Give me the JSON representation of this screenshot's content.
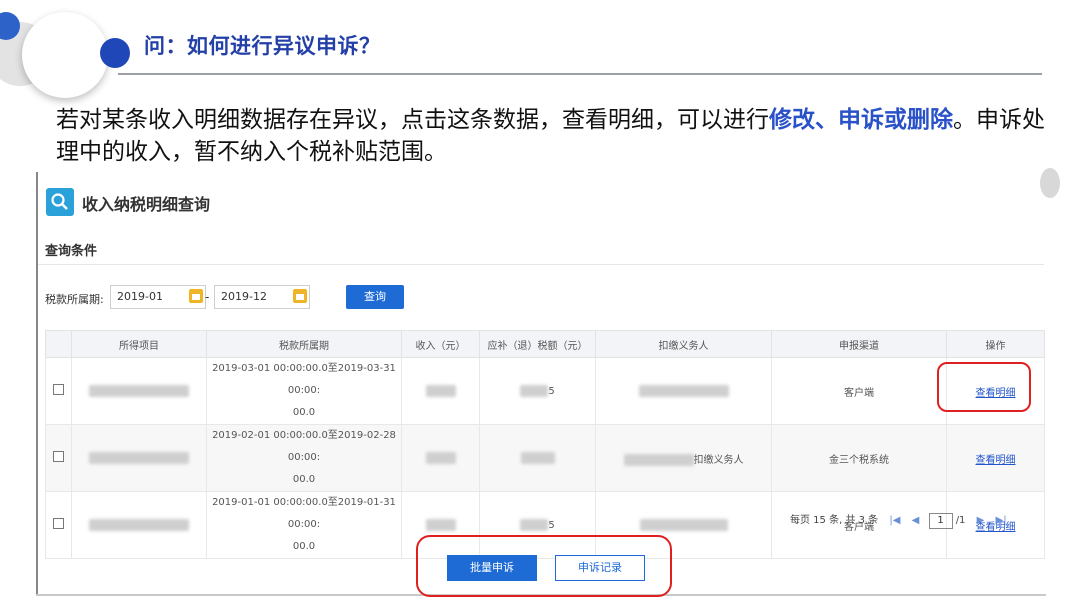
{
  "slide": {
    "question": "问：如何进行异议申诉？",
    "intro_part1": "若对某条收入明细数据存在异议，点击这条数据，查看明细，可以进行",
    "intro_highlight": "修改、申诉或删除",
    "intro_part2": "。申诉处理中的收入，暂不纳入个税补贴范围。"
  },
  "panel": {
    "title": "收入纳税明细查询",
    "section_title": "查询条件",
    "period_label": "税款所属期:",
    "date_from": "2019-01",
    "date_separator": "-",
    "date_to": "2019-12",
    "query_button": "查询"
  },
  "table": {
    "headers": [
      "",
      "所得项目",
      "税款所属期",
      "收入（元）",
      "应补（退）税额（元）",
      "扣缴义务人",
      "申报渠道",
      "操作"
    ],
    "rows": [
      {
        "period_line1": "2019-03-01 00:00:00.0至2019-03-31 00:00:",
        "period_line2": "00.0",
        "tax_suffix": "5",
        "channel": "客户端",
        "action": "查看明细"
      },
      {
        "period_line1": "2019-02-01 00:00:00.0至2019-02-28 00:00:",
        "period_line2": "00.0",
        "withholder": "扣缴义务人",
        "channel": "金三个税系统",
        "action": "查看明细"
      },
      {
        "period_line1": "2019-01-01 00:00:00.0至2019-01-31 00:00:",
        "period_line2": "00.0",
        "tax_suffix": "5",
        "channel": "客户端",
        "action": "查看明细"
      }
    ]
  },
  "pager": {
    "summary": "每页 15 条, 共 3 条",
    "current_page": "1",
    "total_pages": "/1"
  },
  "actions": {
    "batch_appeal": "批量申诉",
    "appeal_record": "申诉记录"
  }
}
